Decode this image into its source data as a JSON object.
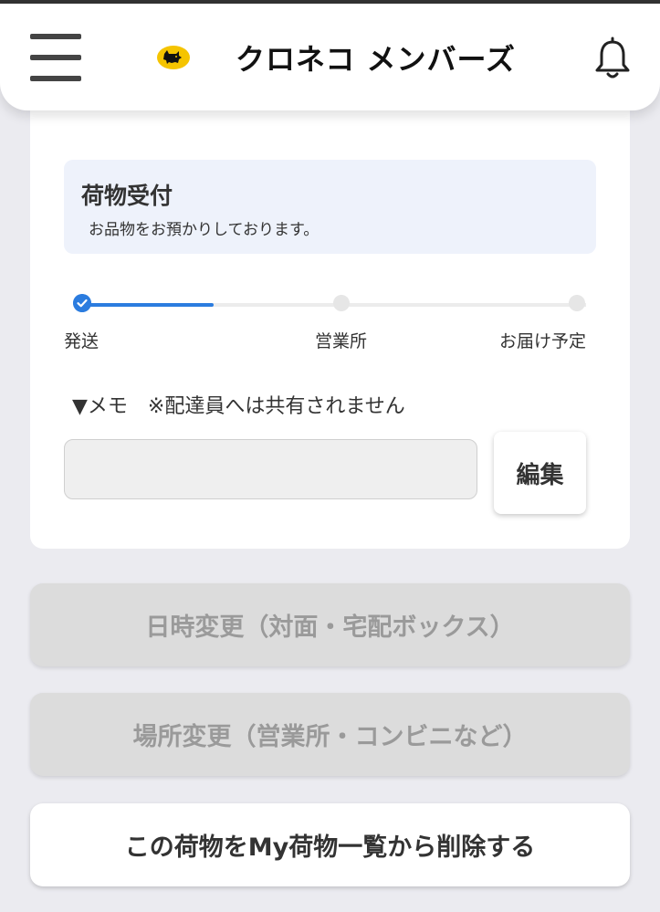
{
  "header": {
    "brand": "クロネコ メンバーズ"
  },
  "status": {
    "title": "荷物受付",
    "description": "お品物をお預かりしております。"
  },
  "progress": {
    "fraction": 0.26,
    "steps": [
      "発送",
      "営業所",
      "お届け予定"
    ]
  },
  "memo": {
    "label": "▼メモ　※配達員へは共有されません",
    "value": "",
    "edit_label": "編集"
  },
  "actions": {
    "change_datetime": "日時変更（対面・宅配ボックス）",
    "change_location": "場所変更（営業所・コンビニなど）",
    "remove": "この荷物をMy荷物一覧から削除する"
  },
  "colors": {
    "accent": "#2b7cdf",
    "logo_yellow": "#f5c400",
    "status_bg": "#eef2fb",
    "disabled_bg": "#dcdcdc"
  },
  "icons": [
    "hamburger-menu-icon",
    "black-cat-logo",
    "bell-icon",
    "check-icon"
  ]
}
